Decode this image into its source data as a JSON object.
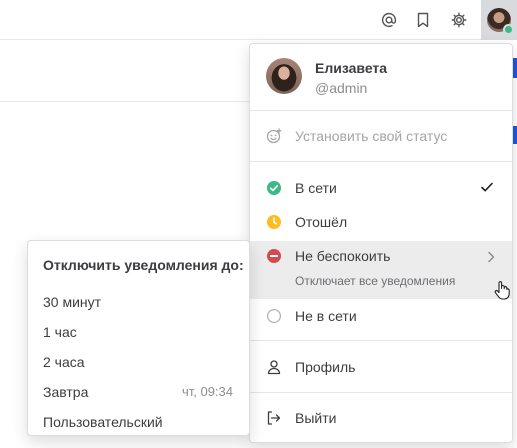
{
  "header": {
    "icons": [
      "at-mention-icon",
      "bookmark-icon",
      "gear-icon"
    ],
    "user_status_color": "#3db887"
  },
  "menu": {
    "profile": {
      "name": "Елизавета",
      "handle": "@admin"
    },
    "set_status": "Установить свой статус",
    "statuses": [
      {
        "label": "В сети",
        "color": "#3db887",
        "selected": true
      },
      {
        "label": "Отошёл",
        "color": "#ffbc1f",
        "selected": false
      },
      {
        "label": "Не беспокоить",
        "color": "#d24b4e",
        "selected": false,
        "sub": "Отключает все уведомления",
        "has_submenu": true
      },
      {
        "label": "Не в сети",
        "color": "#ffffff",
        "selected": false
      }
    ],
    "profile_label": "Профиль",
    "logout_label": "Выйти"
  },
  "submenu": {
    "title": "Отключить уведомления до:",
    "options": [
      {
        "label": "30 минут",
        "time": ""
      },
      {
        "label": "1 час",
        "time": ""
      },
      {
        "label": "2 часа",
        "time": ""
      },
      {
        "label": "Завтра",
        "time": "чт, 09:34"
      },
      {
        "label": "Пользовательский",
        "time": ""
      }
    ]
  }
}
